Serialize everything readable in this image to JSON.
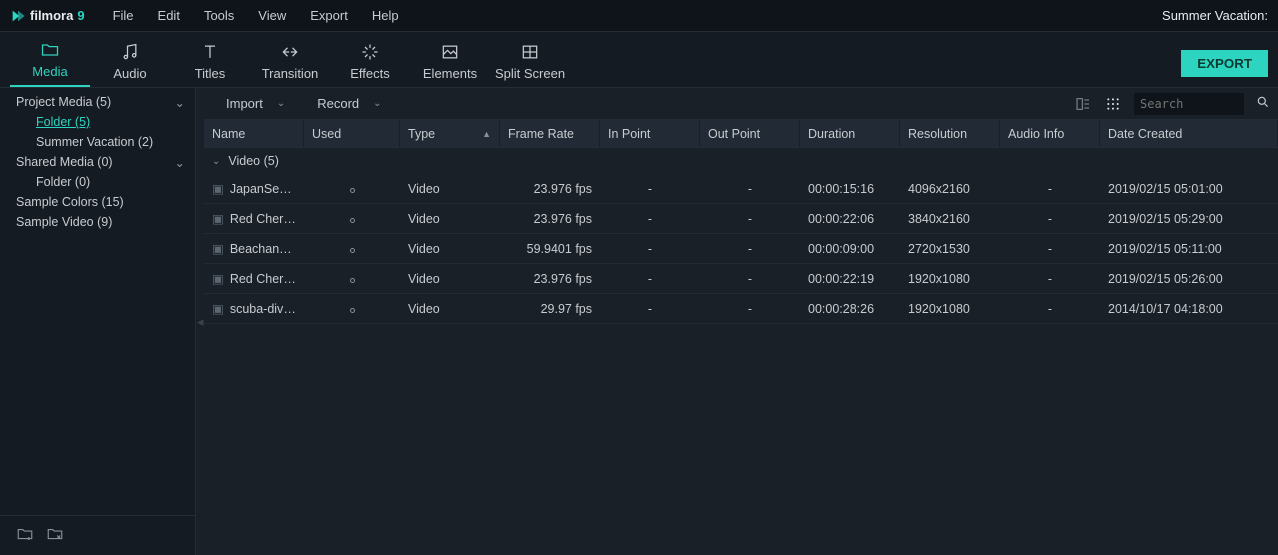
{
  "app": {
    "brand": "filmora",
    "brandSuffix": "9"
  },
  "project_title": "Summer Vacation:",
  "menu": [
    "File",
    "Edit",
    "Tools",
    "View",
    "Export",
    "Help"
  ],
  "tool_tabs": [
    "Media",
    "Audio",
    "Titles",
    "Transition",
    "Effects",
    "Elements",
    "Split Screen"
  ],
  "export_label": "EXPORT",
  "sidebar": {
    "items": [
      {
        "label": "Project Media (5)",
        "level": 1,
        "expand": true
      },
      {
        "label": "Folder (5)",
        "level": 2,
        "selected": true
      },
      {
        "label": "Summer Vacation (2)",
        "level": 2
      },
      {
        "label": "Shared Media (0)",
        "level": 1,
        "expand": true
      },
      {
        "label": "Folder (0)",
        "level": 2
      },
      {
        "label": "Sample Colors (15)",
        "level": 1
      },
      {
        "label": "Sample Video (9)",
        "level": 1
      }
    ]
  },
  "toolbar": {
    "import": "Import",
    "record": "Record",
    "search_placeholder": "Search"
  },
  "table": {
    "columns": [
      "Name",
      "Used",
      "Type",
      "Frame Rate",
      "In Point",
      "Out Point",
      "Duration",
      "Resolution",
      "Audio Info",
      "Date Created"
    ],
    "sort_col": "Type",
    "group_label": "Video (5)",
    "rows": [
      {
        "name": "JapanSeaD...",
        "used": true,
        "type": "Video",
        "fr": "23.976 fps",
        "in": "-",
        "out": "-",
        "dur": "00:00:15:16",
        "res": "4096x2160",
        "ai": "-",
        "dc": "2019/02/15 05:01:00"
      },
      {
        "name": "Red Cherry...",
        "used": true,
        "type": "Video",
        "fr": "23.976 fps",
        "in": "-",
        "out": "-",
        "dur": "00:00:22:06",
        "res": "3840x2160",
        "ai": "-",
        "dc": "2019/02/15 05:29:00"
      },
      {
        "name": "Beachand...",
        "used": true,
        "type": "Video",
        "fr": "59.9401 fps",
        "in": "-",
        "out": "-",
        "dur": "00:00:09:00",
        "res": "2720x1530",
        "ai": "-",
        "dc": "2019/02/15 05:11:00"
      },
      {
        "name": "Red Cherry...",
        "used": true,
        "type": "Video",
        "fr": "23.976 fps",
        "in": "-",
        "out": "-",
        "dur": "00:00:22:19",
        "res": "1920x1080",
        "ai": "-",
        "dc": "2019/02/15 05:26:00"
      },
      {
        "name": "scuba-dive...",
        "used": true,
        "type": "Video",
        "fr": "29.97 fps",
        "in": "-",
        "out": "-",
        "dur": "00:00:28:26",
        "res": "1920x1080",
        "ai": "-",
        "dc": "2014/10/17 04:18:00"
      }
    ]
  }
}
